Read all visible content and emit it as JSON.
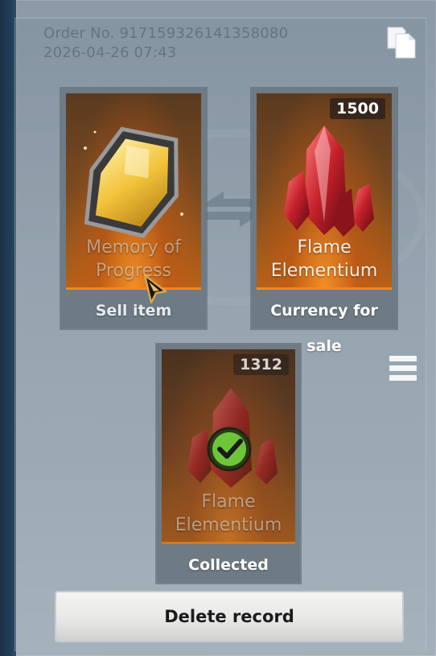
{
  "order": {
    "number_text": "Order No. 917159326141358080",
    "datetime": "2026-04-26 07:43"
  },
  "sell_card": {
    "item_name_line1": "Memory of",
    "item_name_line2": "Progress",
    "caption": "Sell item"
  },
  "currency_card": {
    "quantity": "1500",
    "item_name_line1": "Flame",
    "item_name_line2": "Elementium",
    "caption": "Currency for sale"
  },
  "collected_card": {
    "quantity": "1312",
    "item_name_line1": "Flame",
    "item_name_line2": "Elementium",
    "caption": "Collected",
    "status": "collected"
  },
  "delete_button_label": "Delete record",
  "icons": {
    "copy": "copy-icon",
    "menu": "menu-icon",
    "swap": "swap-arrows-icon",
    "check": "check-icon",
    "cursor": "pointer-cursor-icon"
  },
  "colors": {
    "accent_orange": "#f08a20",
    "check_green": "#6fc53a",
    "crystal_red": "#c4202a"
  }
}
